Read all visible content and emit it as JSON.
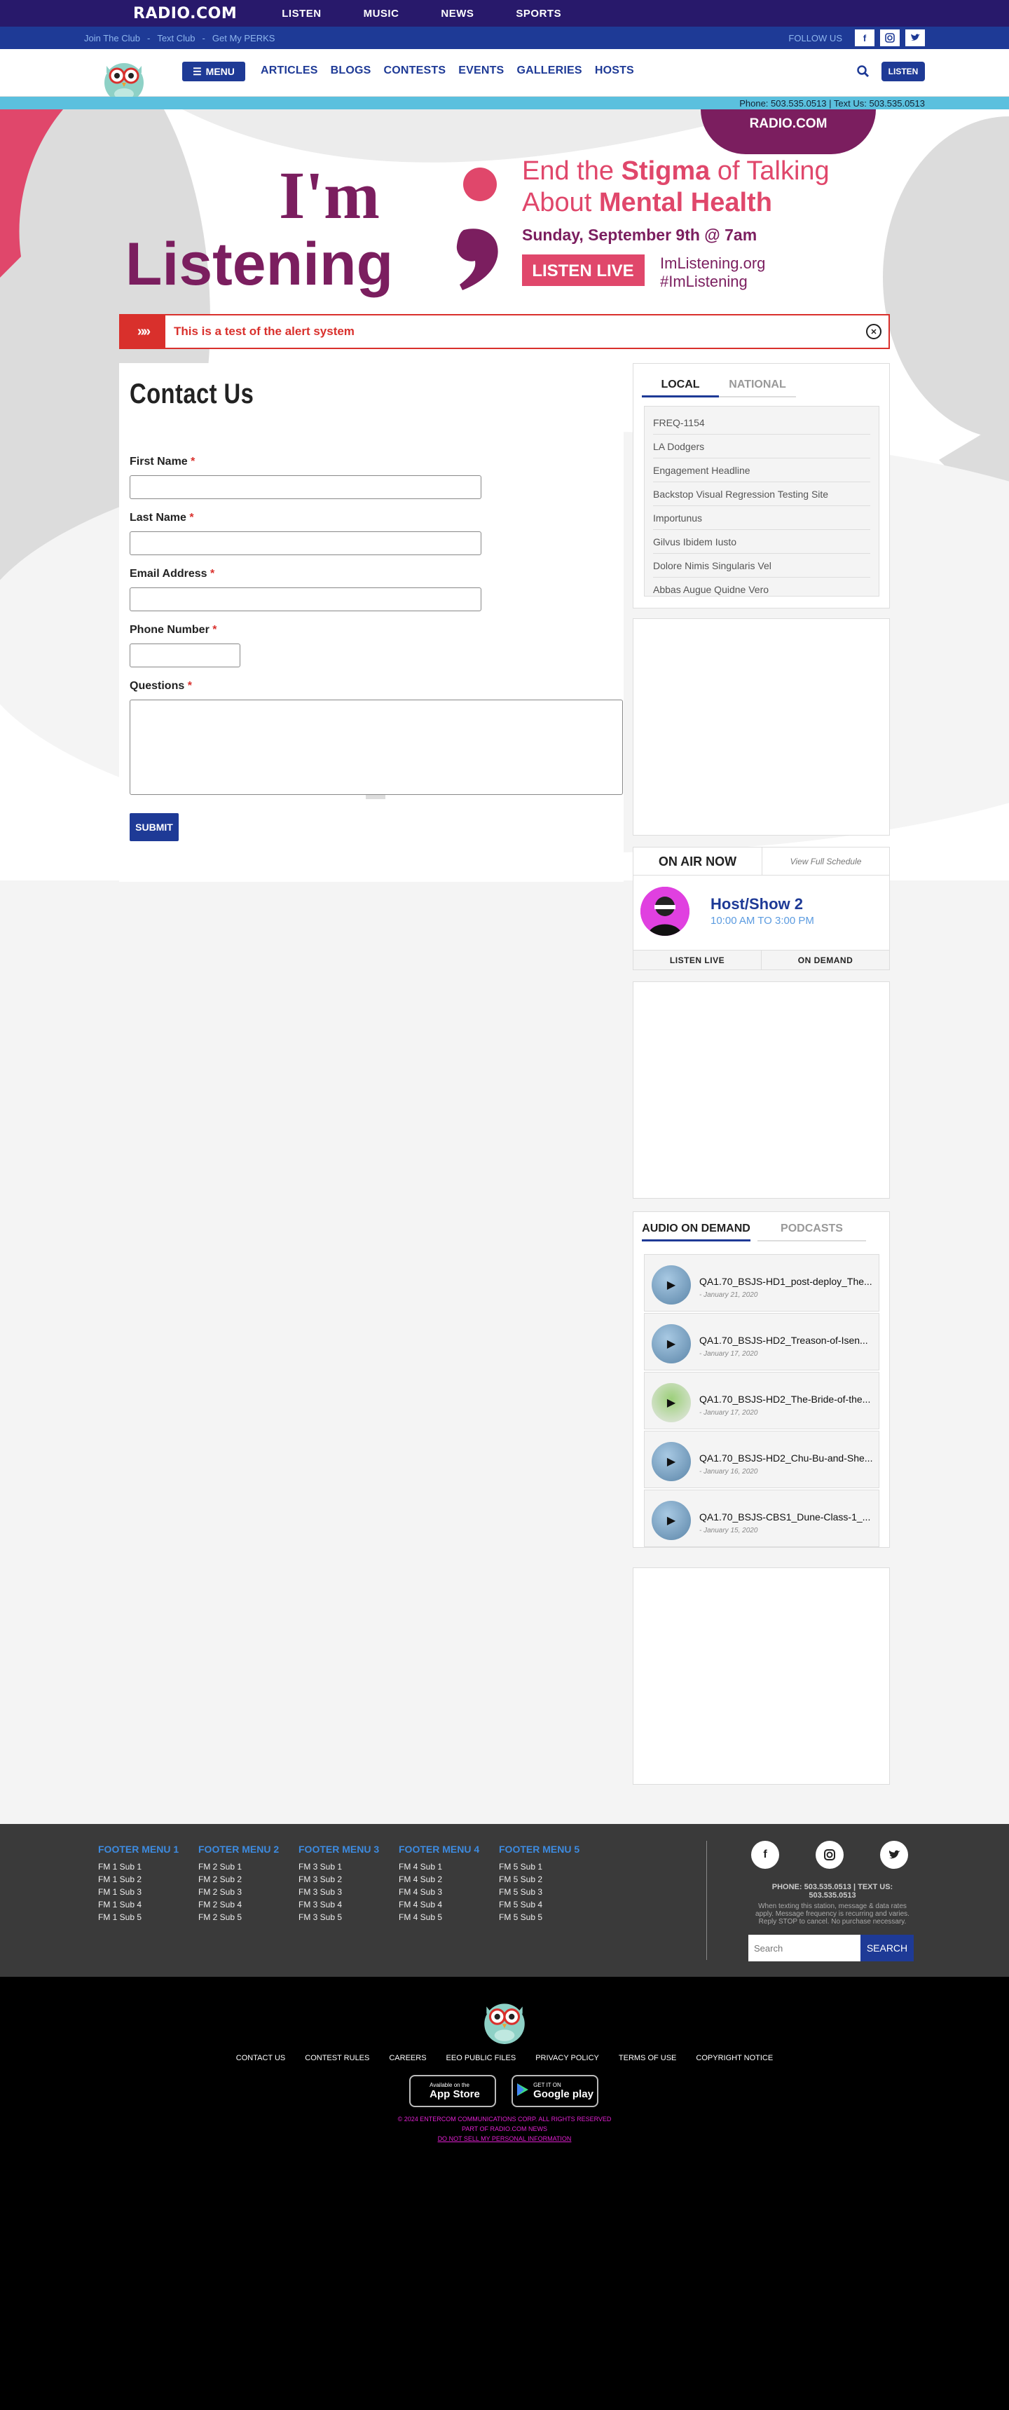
{
  "network": {
    "logo": "RADIO.COM",
    "nav": [
      "LISTEN",
      "MUSIC",
      "NEWS",
      "SPORTS"
    ]
  },
  "clubbar": {
    "links": [
      "Join The Club",
      "-",
      "Text Club",
      "-",
      "Get My PERKS"
    ],
    "follow_label": "FOLLOW US",
    "social_icons": [
      "facebook-icon",
      "instagram-icon",
      "twitter-icon"
    ]
  },
  "mainnav": {
    "menu_label": "MENU",
    "items": [
      "ARTICLES",
      "BLOGS",
      "CONTESTS",
      "EVENTS",
      "GALLERIES",
      "HOSTS"
    ],
    "listen_label": "LISTEN"
  },
  "phonebar": {
    "text": "Phone: 503.535.0513 | Text Us: 503.535.0513"
  },
  "banner": {
    "badge": "RADIO.COM",
    "line1": "I'm",
    "line2": "Listening",
    "headline_a": "End the ",
    "headline_b": "Stigma",
    "headline_c": " of Talking",
    "headline_d": "About ",
    "headline_e": "Mental Health",
    "date": "Sunday, September 9th @ 7am",
    "cta": "LISTEN LIVE",
    "site": "ImListening.org",
    "hashtag": "#ImListening",
    "colors": {
      "purple": "#7b1e5f",
      "pink": "#e0476b"
    }
  },
  "alert": {
    "message": "This is a test of the alert system"
  },
  "form": {
    "title": "Contact Us",
    "fields": [
      {
        "label": "First Name",
        "req": "*"
      },
      {
        "label": "Last Name",
        "req": "*"
      },
      {
        "label": "Email Address",
        "req": "*"
      },
      {
        "label": "Phone Number",
        "req": "*"
      },
      {
        "label": "Questions",
        "req": "*"
      }
    ],
    "submit": "SUBMIT"
  },
  "sidebar": {
    "tabs": [
      "LOCAL",
      "NATIONAL"
    ],
    "local_items": [
      "FREQ-1154",
      "LA Dodgers",
      "Engagement Headline",
      "Backstop Visual Regression Testing Site",
      "Importunus",
      "Gilvus Ibidem Iusto",
      "Dolore Nimis Singularis Vel",
      "Abbas Augue Quidne Vero"
    ],
    "onair": {
      "title": "ON AIR NOW",
      "schedule": "View Full Schedule",
      "host": "Host/Show 2",
      "time": "10:00 AM TO 3:00 PM",
      "listen_live": "LISTEN LIVE",
      "on_demand": "ON DEMAND"
    },
    "aod": {
      "tabs": [
        "AUDIO ON DEMAND",
        "PODCASTS"
      ],
      "items": [
        {
          "title": "QA1.70_BSJS-HD1_post-deploy_The...",
          "date": "- January 21, 2020"
        },
        {
          "title": "QA1.70_BSJS-HD2_Treason-of-Isen...",
          "date": "- January 17, 2020"
        },
        {
          "title": "QA1.70_BSJS-HD2_The-Bride-of-the...",
          "date": "- January 17, 2020"
        },
        {
          "title": "QA1.70_BSJS-HD2_Chu-Bu-and-She...",
          "date": "- January 16, 2020"
        },
        {
          "title": "QA1.70_BSJS-CBS1_Dune-Class-1_...",
          "date": "- January 15, 2020"
        }
      ]
    }
  },
  "footer": {
    "menus": [
      {
        "title": "FOOTER MENU 1",
        "items": [
          "FM 1 Sub 1",
          "FM 1 Sub 2",
          "FM 1 Sub 3",
          "FM 1 Sub 4",
          "FM 1 Sub 5"
        ]
      },
      {
        "title": "FOOTER MENU 2",
        "items": [
          "FM 2 Sub 1",
          "FM 2 Sub 2",
          "FM 2 Sub 3",
          "FM 2 Sub 4",
          "FM 2 Sub 5"
        ]
      },
      {
        "title": "FOOTER MENU 3",
        "items": [
          "FM 3 Sub 1",
          "FM 3 Sub 2",
          "FM 3 Sub 3",
          "FM 3 Sub 4",
          "FM 3 Sub 5"
        ]
      },
      {
        "title": "FOOTER MENU 4",
        "items": [
          "FM 4 Sub 1",
          "FM 4 Sub 2",
          "FM 4 Sub 3",
          "FM 4 Sub 4",
          "FM 4 Sub 5"
        ]
      },
      {
        "title": "FOOTER MENU 5",
        "items": [
          "FM 5 Sub 1",
          "FM 5 Sub 2",
          "FM 5 Sub 3",
          "FM 5 Sub 4",
          "FM 5 Sub 5"
        ]
      }
    ],
    "contact": "PHONE: 503.535.0513 | TEXT US: 503.535.0513",
    "disclaimer": "When texting this station, message & data rates apply. Message frequency is recurring and varies. Reply STOP to cancel. No purchase necessary.",
    "search_placeholder": "Search",
    "search_button": "SEARCH"
  },
  "bottom": {
    "links": [
      "CONTACT US",
      "CONTEST RULES",
      "CAREERS",
      "EEO PUBLIC FILES",
      "PRIVACY POLICY",
      "TERMS OF USE",
      "COPYRIGHT NOTICE"
    ],
    "appstore_small": "Available on the",
    "appstore_large": "App Store",
    "play_small": "GET IT ON",
    "play_large": "Google play",
    "copyright": "© 2024 ENTERCOM COMMUNICATIONS CORP. ALL RIGHTS RESERVED",
    "part_of": "PART OF RADIO.COM NEWS",
    "dnsmpi": "DO NOT SELL MY PERSONAL INFORMATION"
  }
}
